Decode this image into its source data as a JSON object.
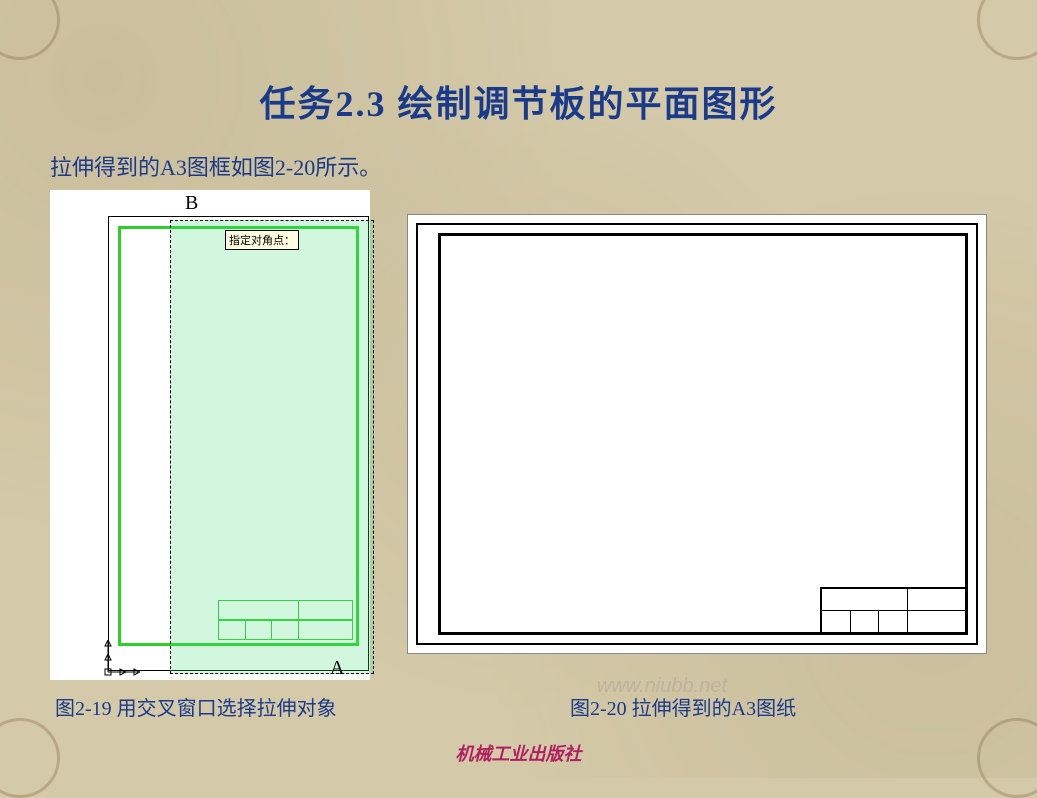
{
  "title": "任务2.3 绘制调节板的平面图形",
  "body_text": "拉伸得到的A3图框如图2-20所示。",
  "figure_left": {
    "label_b": "B",
    "label_a": "A",
    "tooltip": "指定对角点：",
    "caption": "图2-19 用交叉窗口选择拉伸对象"
  },
  "figure_right": {
    "caption": "图2-20 拉伸得到的A3图纸"
  },
  "publisher": "机械工业出版社",
  "watermark": "www.niubb.net"
}
